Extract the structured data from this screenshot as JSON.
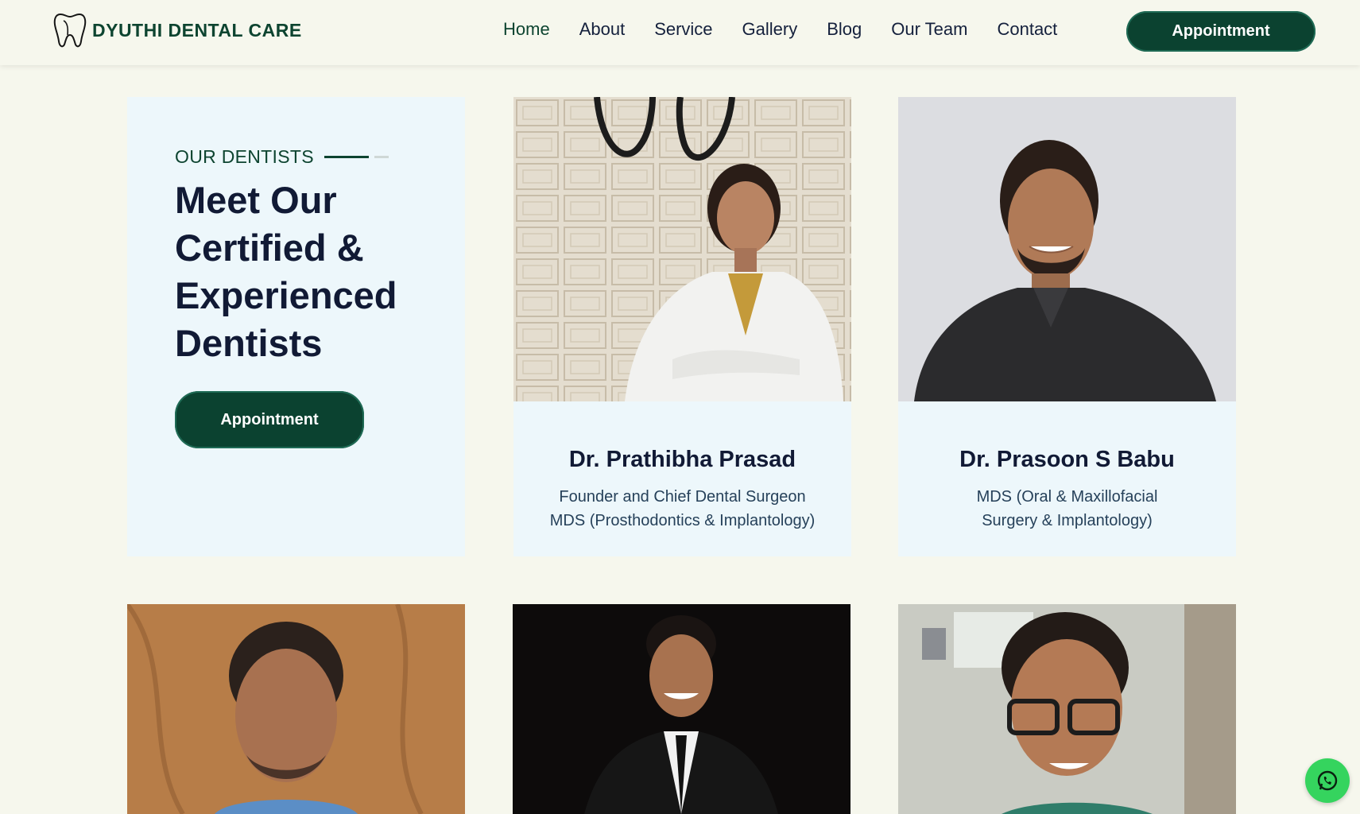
{
  "brand": {
    "name": "DYUTHI DENTAL CARE"
  },
  "nav": {
    "items": [
      {
        "label": "Home"
      },
      {
        "label": "About"
      },
      {
        "label": "Service"
      },
      {
        "label": "Gallery"
      },
      {
        "label": "Blog"
      },
      {
        "label": "Our Team"
      },
      {
        "label": "Contact"
      }
    ],
    "cta_label": "Appointment"
  },
  "intro": {
    "eyebrow": "OUR DENTISTS",
    "heading": "Meet Our Certified & Experienced Dentists",
    "cta_label": "Appointment"
  },
  "dentists": [
    {
      "name": "Dr. Prathibha Prasad",
      "role_line1": "Founder and Chief Dental Surgeon",
      "role_line2": "MDS (Prosthodontics & Implantology)"
    },
    {
      "name": "Dr. Prasoon S Babu",
      "role_line1": "MDS (Oral & Maxillofacial",
      "role_line2": "Surgery & Implantology)"
    }
  ],
  "colors": {
    "page_bg": "#f6f7ed",
    "brand_green": "#0b4230",
    "card_bg": "#edf7fb",
    "heading": "#111a35",
    "whatsapp": "#35d45e"
  },
  "icons": {
    "logo": "tooth-icon",
    "chat": "whatsapp-icon"
  }
}
